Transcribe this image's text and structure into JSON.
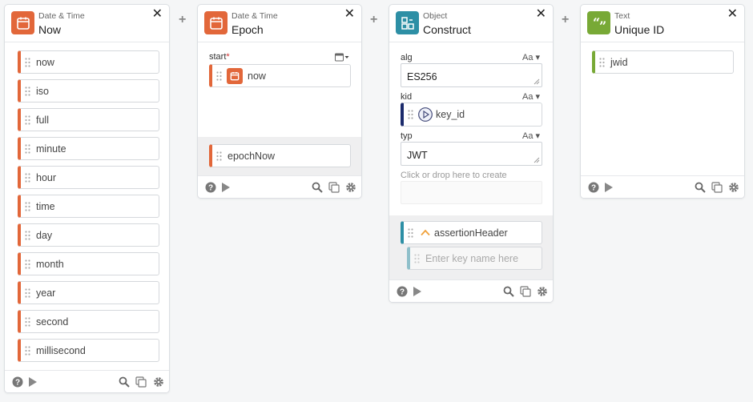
{
  "colors": {
    "datetime": "#e2673a",
    "object": "#2d8fa5",
    "text": "#78a936",
    "navy": "#1b2a6b",
    "teal": "#8fbfca"
  },
  "cards": {
    "now": {
      "category": "Date & Time",
      "title": "Now",
      "icon": "calendar-icon",
      "outputs": [
        "now",
        "iso",
        "full",
        "minute",
        "hour",
        "time",
        "day",
        "month",
        "year",
        "second",
        "millisecond"
      ]
    },
    "epoch": {
      "category": "Date & Time",
      "title": "Epoch",
      "icon": "calendar-icon",
      "start_label": "start",
      "required_mark": "*",
      "start_value": "now",
      "output": "epochNow"
    },
    "construct": {
      "category": "Object",
      "title": "Construct",
      "icon": "object-grid-icon",
      "fields": [
        {
          "label": "alg",
          "type_toggle": "Aa",
          "value": "ES256"
        },
        {
          "label": "kid",
          "type_toggle": "Aa",
          "value": "key_id"
        },
        {
          "label": "typ",
          "type_toggle": "Aa",
          "value": "JWT"
        }
      ],
      "drop_hint": "Click or drop here to create",
      "output": "assertionHeader",
      "key_placeholder": "Enter key name here"
    },
    "unique_id": {
      "category": "Text",
      "title": "Unique ID",
      "icon": "quote-icon",
      "output": "jwid"
    }
  },
  "close_symbol": "✕",
  "plus_symbol": "+"
}
